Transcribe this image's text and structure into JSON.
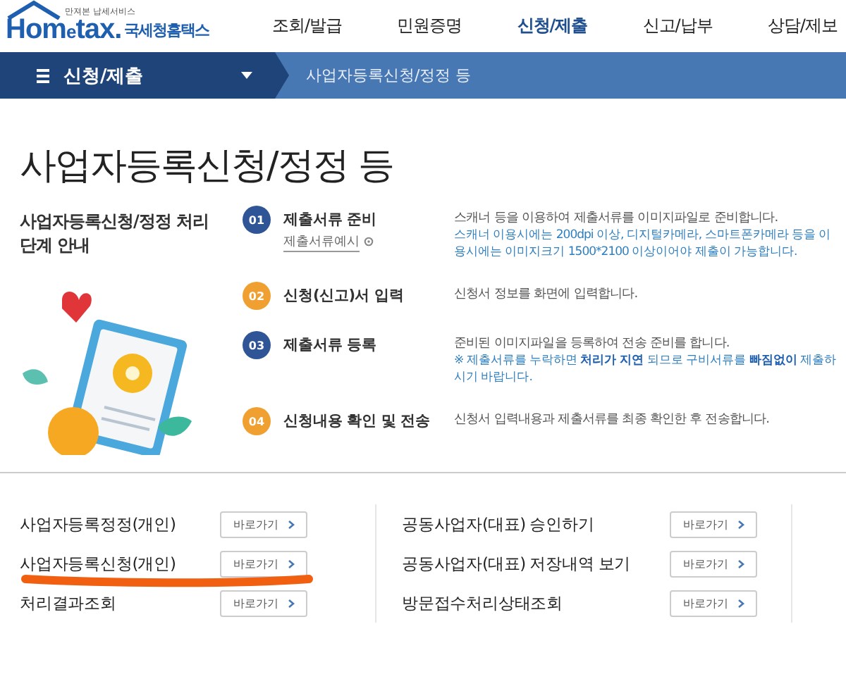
{
  "header": {
    "logo": {
      "tagline": "만져본 납세서비스",
      "brand_prefix": "Hom",
      "brand_e": "e",
      "brand_suffix": "tax.",
      "brand_korean": "국세청홈택스"
    },
    "menu": [
      {
        "label": "조회/발급",
        "selected": false
      },
      {
        "label": "민원증명",
        "selected": false
      },
      {
        "label": "신청/제출",
        "selected": true
      },
      {
        "label": "신고/납부",
        "selected": false
      },
      {
        "label": "상담/제보",
        "selected": false
      }
    ]
  },
  "nav": {
    "section": "신청/제출",
    "breadcrumb": "사업자등록신청/정정 등"
  },
  "page_title": "사업자등록신청/정정 등",
  "guide": {
    "title": "사업자등록신청/정정 처리단계 안내",
    "steps": [
      {
        "number": "01",
        "color": "#2f5597",
        "name": "제출서류 준비",
        "link": "제출서류예시",
        "description": "스캐너 등을 이용하여 제출서류를 이미지파일로 준비합니다.",
        "note": "스캐너 이용시에는 200dpi 이상, 디지털카메라, 스마트폰카메라 등을 이용시에는 이미지크기 1500*2100 이상이어야 제출이 가능합니다."
      },
      {
        "number": "02",
        "color": "#f0a030",
        "name": "신청(신고)서 입력",
        "description": "신청서 정보를 화면에 입력합니다."
      },
      {
        "number": "03",
        "color": "#2f5597",
        "name": "제출서류 등록",
        "description": "준비된 이미지파일을 등록하여 전송 준비를 합니다.",
        "note": "※ 제출서류를 누락하면 **처리가 지연** 되므로 구비서류를 **빠짐없이** 제출하시기 바랍니다."
      },
      {
        "number": "04",
        "color": "#f0a030",
        "name": "신청내용 확인 및 전송",
        "description": "신청서 입력내용과 제출서류를 최종 확인한 후 전송합니다."
      }
    ]
  },
  "shortcuts": [
    [
      {
        "label": "사업자등록정정(개인)",
        "button": "바로가기",
        "marked": false
      },
      {
        "label": "사업자등록신청(개인)",
        "button": "바로가기",
        "marked": true
      },
      {
        "label": "처리결과조회",
        "button": "바로가기",
        "marked": false
      }
    ],
    [
      {
        "label": "공동사업자(대표) 승인하기",
        "button": "바로가기",
        "marked": false
      },
      {
        "label": "공동사업자(대표) 저장내역 보기",
        "button": "바로가기",
        "marked": false
      },
      {
        "label": "방문접수처리상태조회",
        "button": "바로가기",
        "marked": false
      }
    ]
  ]
}
